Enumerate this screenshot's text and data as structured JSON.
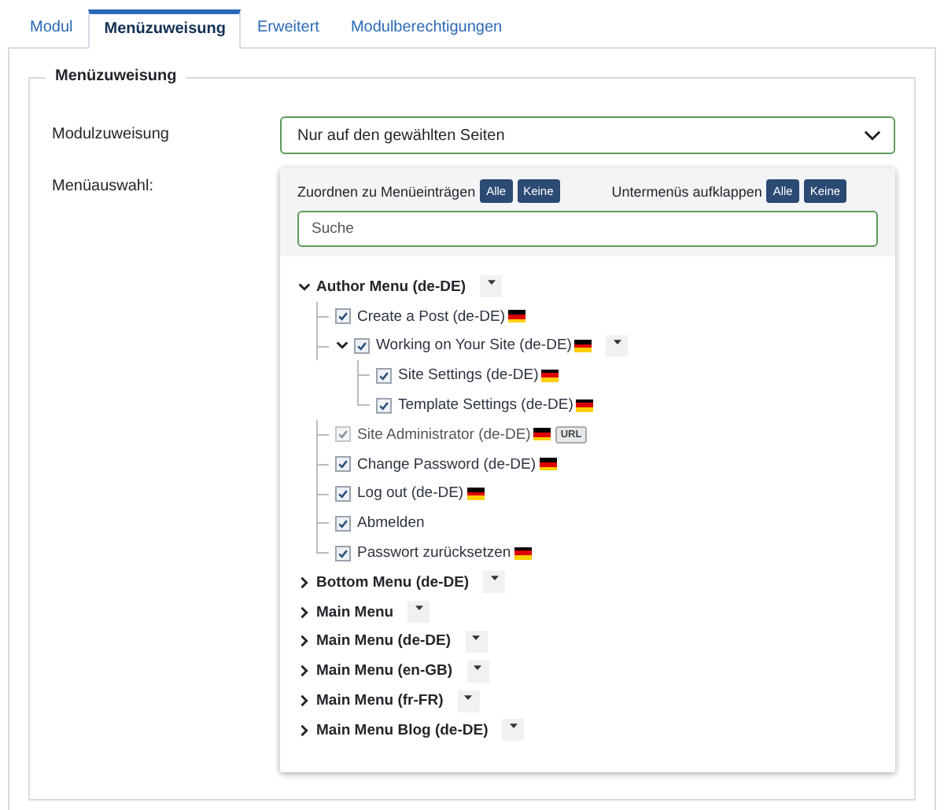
{
  "tabs": [
    {
      "label": "Modul",
      "selected": false
    },
    {
      "label": "Menüzuweisung",
      "selected": true
    },
    {
      "label": "Erweitert",
      "selected": false
    },
    {
      "label": "Modulberechtigungen",
      "selected": false
    }
  ],
  "fieldset": {
    "legend": "Menüzuweisung",
    "assignment": {
      "label": "Modulzuweisung",
      "value": "Nur auf den gewählten Seiten"
    },
    "selection": {
      "label": "Menüauswahl:",
      "assign_label": "Zuordnen zu Menüeinträgen",
      "assign_buttons": [
        "Alle",
        "Keine"
      ],
      "expand_label": "Untermenüs aufklappen",
      "expand_buttons": [
        "Alle",
        "Keine"
      ],
      "search": {
        "placeholder": "Suche"
      },
      "menus": [
        {
          "label": "Author Menu (de-DE)",
          "expanded": true,
          "children": [
            {
              "label": "Create a Post (de-DE)",
              "checked": true,
              "disabled": false,
              "flag": true,
              "options_button": false
            },
            {
              "label": "Working on Your Site (de-DE)",
              "checked": true,
              "disabled": false,
              "flag": true,
              "options_button": true,
              "expanded": true,
              "children": [
                {
                  "label": "Site Settings (de-DE)",
                  "checked": true,
                  "disabled": false,
                  "flag": true,
                  "options_button": false
                },
                {
                  "label": "Template Settings (de-DE)",
                  "checked": true,
                  "disabled": false,
                  "flag": true,
                  "options_button": false
                }
              ]
            },
            {
              "label": "Site Administrator (de-DE)",
              "checked": true,
              "disabled": true,
              "flag": true,
              "options_button": false,
              "badge": "URL"
            },
            {
              "label": "Change Password (de-DE)",
              "checked": true,
              "disabled": false,
              "flag": true,
              "options_button": false
            },
            {
              "label": "Log out (de-DE)",
              "checked": true,
              "disabled": false,
              "flag": true,
              "options_button": false
            },
            {
              "label": "Abmelden",
              "checked": true,
              "disabled": false,
              "flag": false,
              "options_button": false
            },
            {
              "label": "Passwort zurücksetzen",
              "checked": true,
              "disabled": false,
              "flag": true,
              "options_button": false
            }
          ]
        },
        {
          "label": "Bottom Menu (de-DE)",
          "expanded": false
        },
        {
          "label": "Main Menu",
          "expanded": false
        },
        {
          "label": "Main Menu (de-DE)",
          "expanded": false
        },
        {
          "label": "Main Menu (en-GB)",
          "expanded": false
        },
        {
          "label": "Main Menu (fr-FR)",
          "expanded": false
        },
        {
          "label": "Main Menu Blog (de-DE)",
          "expanded": false
        }
      ]
    }
  }
}
